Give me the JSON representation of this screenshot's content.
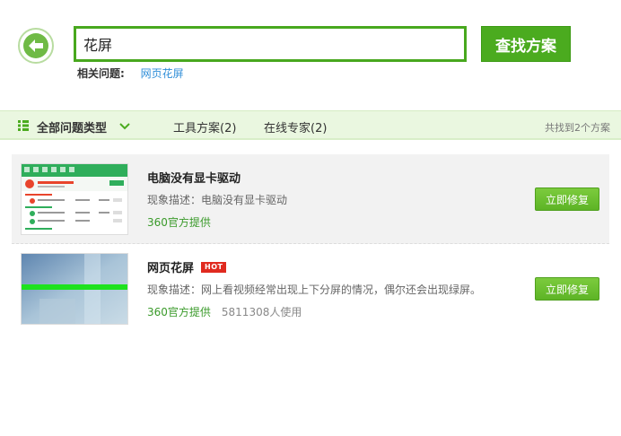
{
  "search": {
    "query": "花屏",
    "button_label": "查找方案"
  },
  "related": {
    "label": "相关问题:",
    "links": [
      "网页花屏"
    ]
  },
  "filter": {
    "all_types": "全部问题类型",
    "tools": "工具方案(2)",
    "experts": "在线专家(2)",
    "found": "共找到2个方案"
  },
  "results": [
    {
      "title": "电脑没有显卡驱动",
      "desc": "现象描述：电脑没有显卡驱动",
      "provider": "360官方提供",
      "fix_label": "立即修复"
    },
    {
      "title": "网页花屏",
      "badge": "HOT",
      "desc": "现象描述：网上看视频经常出现上下分屏的情况，偶尔还会出现绿屏。",
      "provider": "360官方提供",
      "usage": "5811308人使用",
      "fix_label": "立即修复"
    }
  ],
  "colors": {
    "accent": "#4bab1f",
    "filter_bg": "#eaf7e0",
    "link": "#2f8ed8",
    "hot": "#e02a1f"
  },
  "icons": [
    "back-arrow-icon",
    "grid-list-icon",
    "chevron-down-icon"
  ]
}
